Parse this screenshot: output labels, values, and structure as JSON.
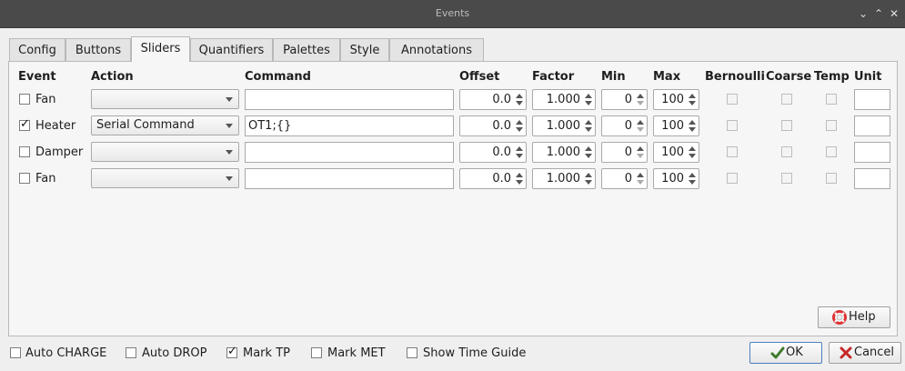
{
  "window": {
    "title": "Events"
  },
  "tabs": [
    "Config",
    "Buttons",
    "Sliders",
    "Quantifiers",
    "Palettes",
    "Style",
    "Annotations"
  ],
  "active_tab": "Sliders",
  "columns": [
    "Event",
    "Action",
    "Command",
    "Offset",
    "Factor",
    "Min",
    "Max",
    "Bernoulli",
    "Coarse",
    "Temp",
    "Unit"
  ],
  "rows": [
    {
      "enabled": false,
      "event": "Fan",
      "action": "",
      "command": "",
      "offset": "0.0",
      "factor": "1.000",
      "min": "0",
      "max": "100",
      "bernoulli": false,
      "coarse": false,
      "temp": false,
      "unit": ""
    },
    {
      "enabled": true,
      "event": "Heater",
      "action": "Serial Command",
      "command": "OT1;{}",
      "offset": "0.0",
      "factor": "1.000",
      "min": "0",
      "max": "100",
      "bernoulli": false,
      "coarse": false,
      "temp": false,
      "unit": ""
    },
    {
      "enabled": false,
      "event": "Damper",
      "action": "",
      "command": "",
      "offset": "0.0",
      "factor": "1.000",
      "min": "0",
      "max": "100",
      "bernoulli": false,
      "coarse": false,
      "temp": false,
      "unit": ""
    },
    {
      "enabled": false,
      "event": "Fan",
      "action": "",
      "command": "",
      "offset": "0.0",
      "factor": "1.000",
      "min": "0",
      "max": "100",
      "bernoulli": false,
      "coarse": false,
      "temp": false,
      "unit": ""
    }
  ],
  "buttons": {
    "help": "Help",
    "ok": "OK",
    "cancel": "Cancel"
  },
  "footer_options": [
    {
      "label": "Auto CHARGE",
      "checked": false
    },
    {
      "label": "Auto DROP",
      "checked": false
    },
    {
      "label": "Mark TP",
      "checked": true
    },
    {
      "label": "Mark MET",
      "checked": false
    },
    {
      "label": "Show Time Guide",
      "checked": false
    }
  ]
}
